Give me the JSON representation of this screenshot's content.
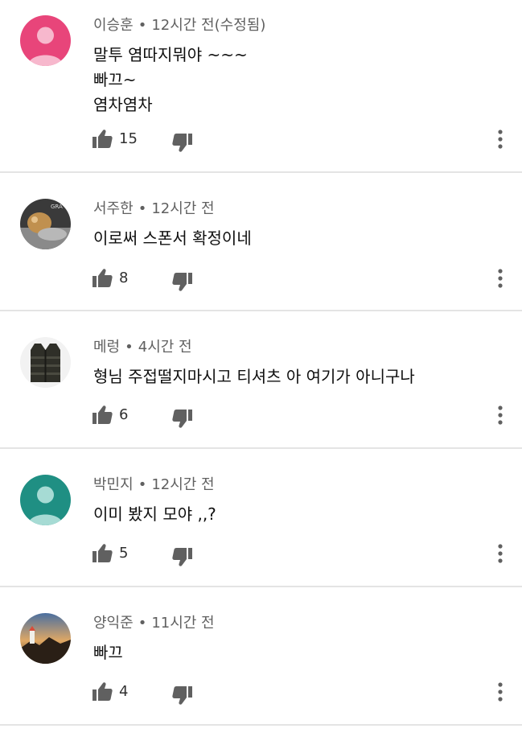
{
  "comments": [
    {
      "author": "이승훈",
      "time": "12시간 전(수정됨)",
      "lines": [
        "말투 염따지뭐야 ~~~",
        "빠끄~",
        "염차염차"
      ],
      "likes": "15",
      "avatar": "default-avatar-pink"
    },
    {
      "author": "서주한",
      "time": "12시간 전",
      "lines": [
        "이로써 스폰서 확정이네"
      ],
      "likes": "8",
      "avatar": "photo-avatar-animal"
    },
    {
      "author": "메렁",
      "time": "4시간 전",
      "lines": [
        "형님 주접떨지마시고 티셔츠 아 여기가 아니구나"
      ],
      "likes": "6",
      "avatar": "photo-avatar-vest"
    },
    {
      "author": "박민지",
      "time": "12시간 전",
      "lines": [
        "이미 봤지 모야 ,,?"
      ],
      "likes": "5",
      "avatar": "default-avatar-teal"
    },
    {
      "author": "양익준",
      "time": "11시간 전",
      "lines": [
        "빠끄"
      ],
      "likes": "4",
      "avatar": "photo-avatar-landscape"
    }
  ],
  "separator": "•",
  "colors": {
    "avatar_pink": "#e8457a",
    "avatar_teal": "#1f8f83",
    "meta_text": "#606060",
    "divider": "#e4e4e4"
  }
}
